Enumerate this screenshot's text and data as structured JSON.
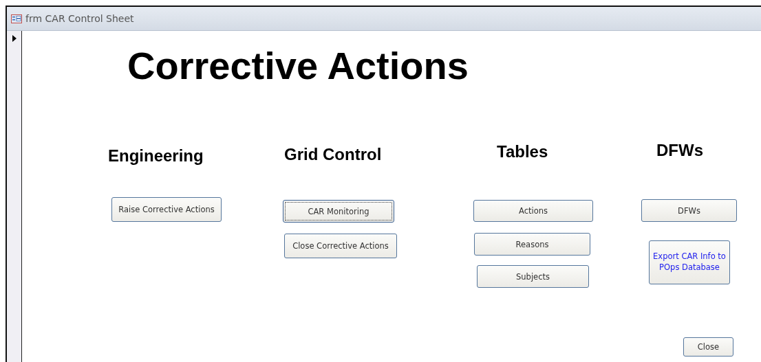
{
  "window": {
    "title": "frm CAR Control Sheet"
  },
  "record_selector": {
    "current": true
  },
  "form": {
    "title": "Corrective Actions",
    "sections": [
      {
        "heading": "Engineering"
      },
      {
        "heading": "Grid Control"
      },
      {
        "heading": "Tables"
      },
      {
        "heading": "DFWs"
      }
    ],
    "buttons": [
      {
        "label": "Raise Corrective Actions",
        "kind": "plain",
        "focused": false
      },
      {
        "label": "CAR Monitoring",
        "kind": "plain",
        "focused": true
      },
      {
        "label": "Close Corrective Actions",
        "kind": "plain",
        "focused": false
      },
      {
        "label": "Actions",
        "kind": "plain",
        "focused": false
      },
      {
        "label": "Reasons",
        "kind": "plain",
        "focused": false
      },
      {
        "label": "Subjects",
        "kind": "plain",
        "focused": false
      },
      {
        "label": "DFWs",
        "kind": "plain",
        "focused": false
      },
      {
        "label": "Export CAR Info to POps Database",
        "kind": "hyperlink",
        "focused": false
      },
      {
        "label": "Close",
        "kind": "plain",
        "focused": false
      }
    ]
  }
}
